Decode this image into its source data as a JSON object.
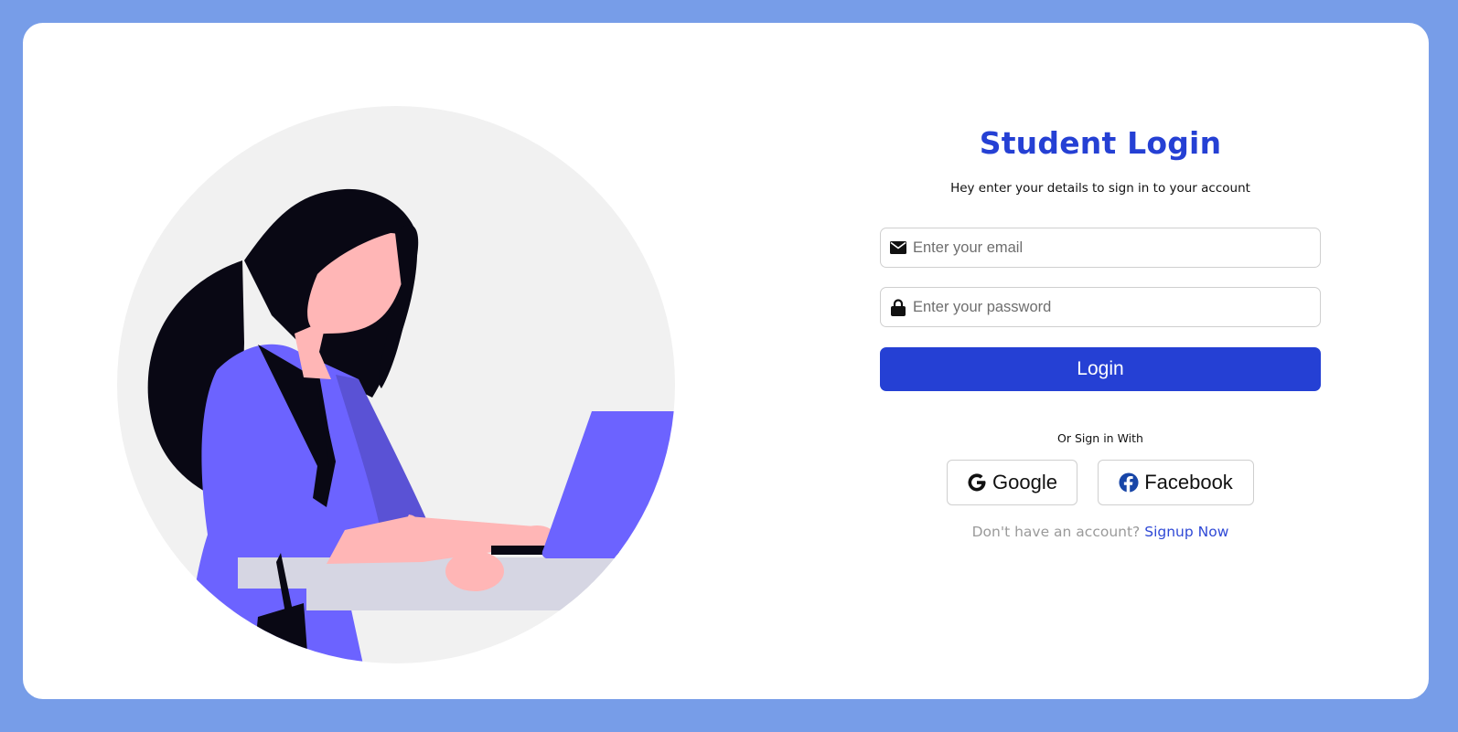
{
  "page": {
    "title": "Student Login",
    "subtitle": "Hey enter your details to sign in to your account"
  },
  "colors": {
    "background": "#779de8",
    "card": "#ffffff",
    "accent": "#2540d4",
    "link": "#2f49d6",
    "illustration_circle": "#f1f1f1",
    "illustration_purple": "#6c63ff",
    "illustration_skin": "#ffb6b6",
    "illustration_hair": "#090814"
  },
  "form": {
    "email": {
      "placeholder": "Enter your email",
      "value": "",
      "icon": "envelope-icon"
    },
    "password": {
      "placeholder": "Enter your password",
      "value": "",
      "icon": "lock-icon"
    },
    "login_label": "Login"
  },
  "social": {
    "divider_text": "Or Sign in With",
    "google_label": "Google",
    "google_icon": "google-icon",
    "facebook_label": "Facebook",
    "facebook_icon": "facebook-icon"
  },
  "signup": {
    "prompt": "Don't have an account?",
    "link_label": "Signup Now"
  }
}
